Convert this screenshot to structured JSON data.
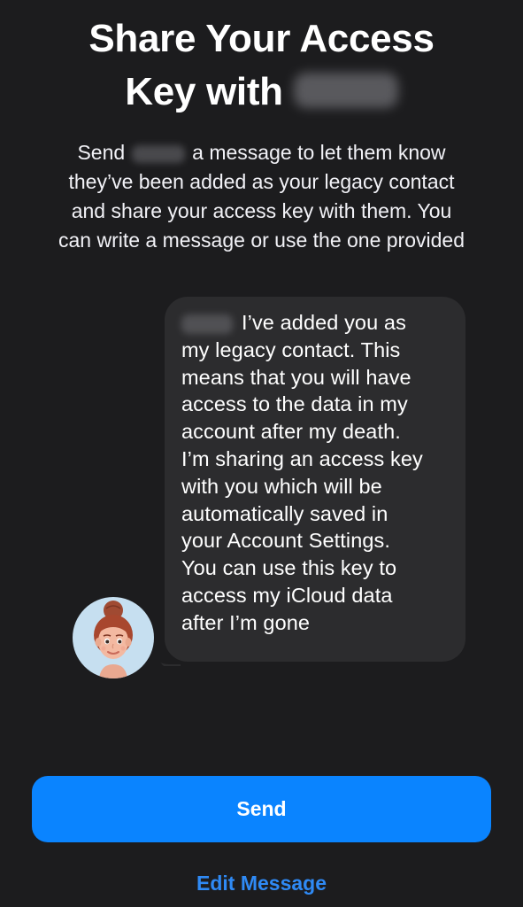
{
  "title": {
    "line1": "Share Your Access",
    "line2_prefix": "Key with"
  },
  "subtitle": {
    "line1_prefix": "Send",
    "line1_suffix": "a message to let them know",
    "line2": "they’ve been added as your legacy contact",
    "line3": "and share your access key with them. You",
    "line4": "can write a message or use the one provided"
  },
  "message": {
    "line1_suffix": "I’ve added you as",
    "lines": [
      "my legacy contact. This",
      "means that you will have",
      "access to the data in my",
      "account after my death.",
      "I’m sharing an access key",
      "with you which will be",
      "automatically saved in",
      "your Account Settings.",
      "You can use this key to",
      "access my iCloud data",
      "after I’m gone"
    ]
  },
  "avatar": {
    "icon": "memoji-avatar-icon",
    "background_color": "#c6dff0"
  },
  "actions": {
    "send_label": "Send",
    "edit_label": "Edit Message"
  },
  "colors": {
    "background": "#1c1c1e",
    "bubble": "#2c2c2e",
    "accent": "#0a84ff",
    "link": "#2f8af5"
  }
}
